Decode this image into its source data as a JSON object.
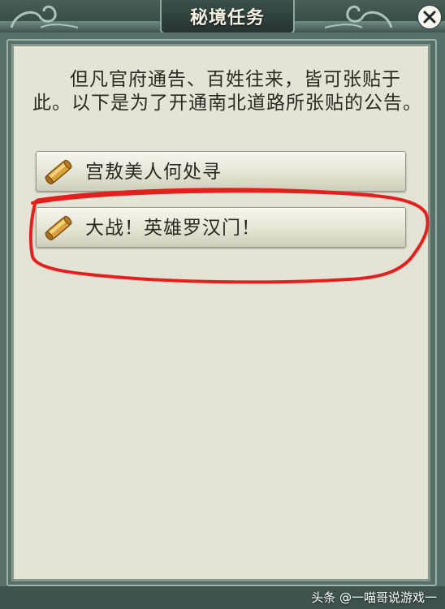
{
  "window": {
    "title": "秘境任务"
  },
  "notice": {
    "text": "但凡官府通告、百姓往来，皆可张贴于此。以下是为了开通南北道路所张贴的公告。"
  },
  "quests": [
    {
      "label": "宫敖美人何处寻",
      "icon": "scroll-icon"
    },
    {
      "label": "大战！英雄罗汉门！",
      "icon": "scroll-icon"
    }
  ],
  "watermark": {
    "text": "头条 @一喵哥说游戏一"
  },
  "colors": {
    "frame": "#55706b",
    "panel": "#e3e3d6",
    "annotation_red": "#e5201c",
    "scroll_gold": "#c98d1c"
  }
}
